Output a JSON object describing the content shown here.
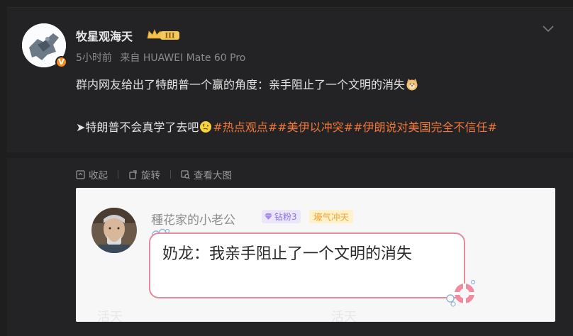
{
  "post": {
    "username": "牧星观海天",
    "level_badge": "III",
    "verified_badge": "V",
    "time": "5小时前",
    "source": "来自 HUAWEI Mate 60 Pro",
    "line1": "群内网友给出了特朗普一个赢的角度：亲手阻止了一个文明的消失",
    "line2_prefix": "➤特朗普不会真学了去吧",
    "tags": [
      "#热点观点#",
      "#美伊以冲突#",
      "#伊朗说对美国完全不信任#"
    ],
    "icons": [
      "doge-emoji",
      "thinking-emoji",
      "chevron-down-icon"
    ]
  },
  "actions": {
    "collapse": "收起",
    "rotate": "旋转",
    "view_large": "查看大图"
  },
  "card": {
    "name": "種花家的小老公",
    "fan_badge": "钻粉3",
    "mood_badge": "壕气冲天",
    "bubble_text": "奶龙：我亲手阻止了一个文明的消失",
    "watermarks": [
      "活天",
      "活天"
    ]
  },
  "colors": {
    "background": "#1e1e1e",
    "post_bg": "#232325",
    "tag": "#f2783c",
    "verified": "#f98a1b",
    "bubble_border": "#e6899c"
  }
}
